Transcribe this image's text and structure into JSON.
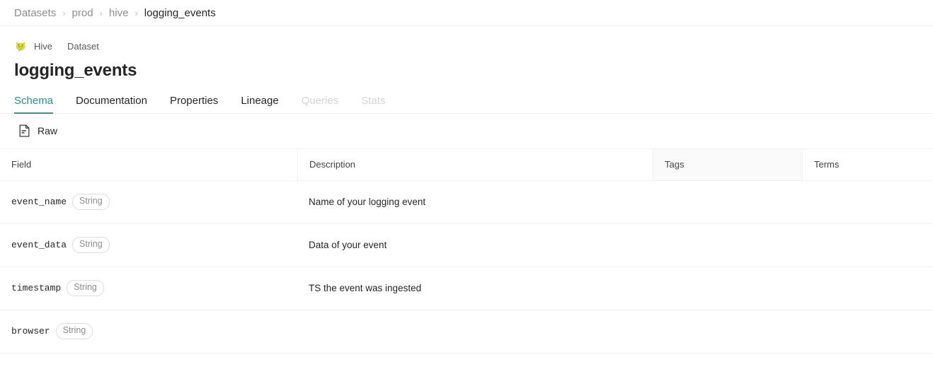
{
  "breadcrumb": {
    "separator": "›",
    "items": [
      {
        "label": "Datasets",
        "current": false
      },
      {
        "label": "prod",
        "current": false
      },
      {
        "label": "hive",
        "current": false
      },
      {
        "label": "logging_events",
        "current": true
      }
    ]
  },
  "entity": {
    "platform_icon": "hive-logo-icon",
    "platform": "Hive",
    "entity_type": "Dataset",
    "title": "logging_events"
  },
  "tabs": [
    {
      "label": "Schema",
      "state": "active"
    },
    {
      "label": "Documentation",
      "state": "enabled"
    },
    {
      "label": "Properties",
      "state": "enabled"
    },
    {
      "label": "Lineage",
      "state": "enabled"
    },
    {
      "label": "Queries",
      "state": "disabled"
    },
    {
      "label": "Stats",
      "state": "disabled"
    }
  ],
  "toolbar": {
    "raw_label": "Raw",
    "raw_icon": "file-document-icon"
  },
  "schema": {
    "columns": [
      {
        "key": "field",
        "label": "Field"
      },
      {
        "key": "description",
        "label": "Description"
      },
      {
        "key": "tags",
        "label": "Tags"
      },
      {
        "key": "terms",
        "label": "Terms"
      }
    ],
    "rows": [
      {
        "field": "event_name",
        "type": "String",
        "description": "Name of your logging event",
        "tags": "",
        "terms": ""
      },
      {
        "field": "event_data",
        "type": "String",
        "description": "Data of your event",
        "tags": "",
        "terms": ""
      },
      {
        "field": "timestamp",
        "type": "String",
        "description": "TS the event was ingested",
        "tags": "",
        "terms": ""
      },
      {
        "field": "browser",
        "type": "String",
        "description": "",
        "tags": "",
        "terms": ""
      }
    ]
  },
  "colors": {
    "accent": "#2e8b8b",
    "accent_underline": "#4f8a80",
    "text_primary": "#262626",
    "text_muted": "#8c8c8c",
    "text_disabled": "#d4d4d4",
    "border": "#f0f0f0",
    "header_cell_bg": "#fafafa"
  }
}
